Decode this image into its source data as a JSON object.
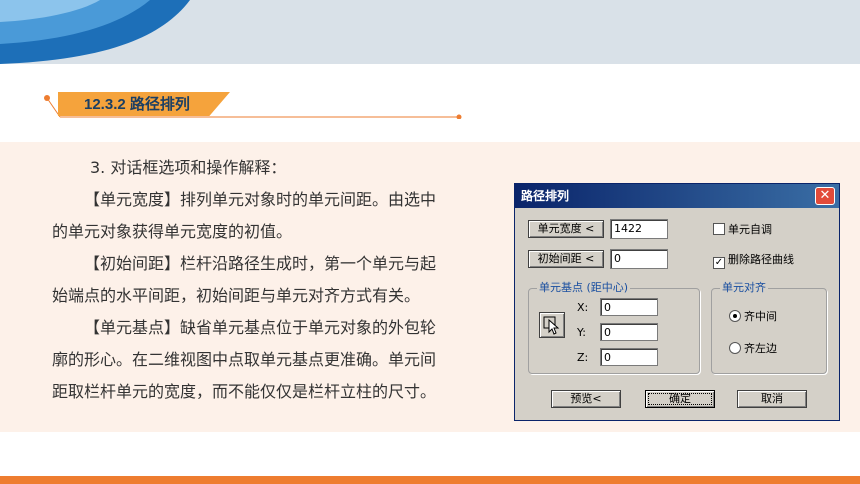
{
  "heading": "12.3.2 路径排列",
  "paragraphs": [
    [
      "3. 对话框选项和操作解释："
    ],
    [
      "【单元宽度】排列单元对象时的单元间距。由选中",
      "的单元对象获得单元宽度的初值。"
    ],
    [
      "【初始间距】栏杆沿路径生成时，第一个单元与起",
      "始端点的水平间距，初始间距与单元对齐方式有关。"
    ],
    [
      "【单元基点】缺省单元基点位于单元对象的外包轮",
      "廓的形心。在二维视图中点取单元基点更准确。单元间",
      "距取栏杆单元的宽度，而不能仅仅是栏杆立柱的尺寸。"
    ]
  ],
  "dialog": {
    "title": "路径排列",
    "close_symbol": "✕",
    "unit_width_button": "单元宽度 <",
    "unit_width_value": "1422",
    "initial_spacing_button": "初始间距 <",
    "initial_spacing_value": "0",
    "auto_adjust_label": "单元自调",
    "auto_adjust_checked": false,
    "delete_path_label": "删除路径曲线",
    "delete_path_checked": true,
    "base_point_group": "单元基点 (距中心)",
    "x_label": "X:",
    "x_value": "0",
    "y_label": "Y:",
    "y_value": "0",
    "z_label": "Z:",
    "z_value": "0",
    "align_group": "单元对齐",
    "align_center_label": "齐中间",
    "align_left_label": "齐左边",
    "align_selected": "center",
    "preview_button": "预览<",
    "ok_button": "确定",
    "cancel_button": "取消"
  },
  "colors": {
    "accent_orange": "#f5a33c",
    "bottom_bar": "#ee7d30",
    "heading_text": "#1c3f63",
    "panel_bg": "#fdf1e9"
  }
}
